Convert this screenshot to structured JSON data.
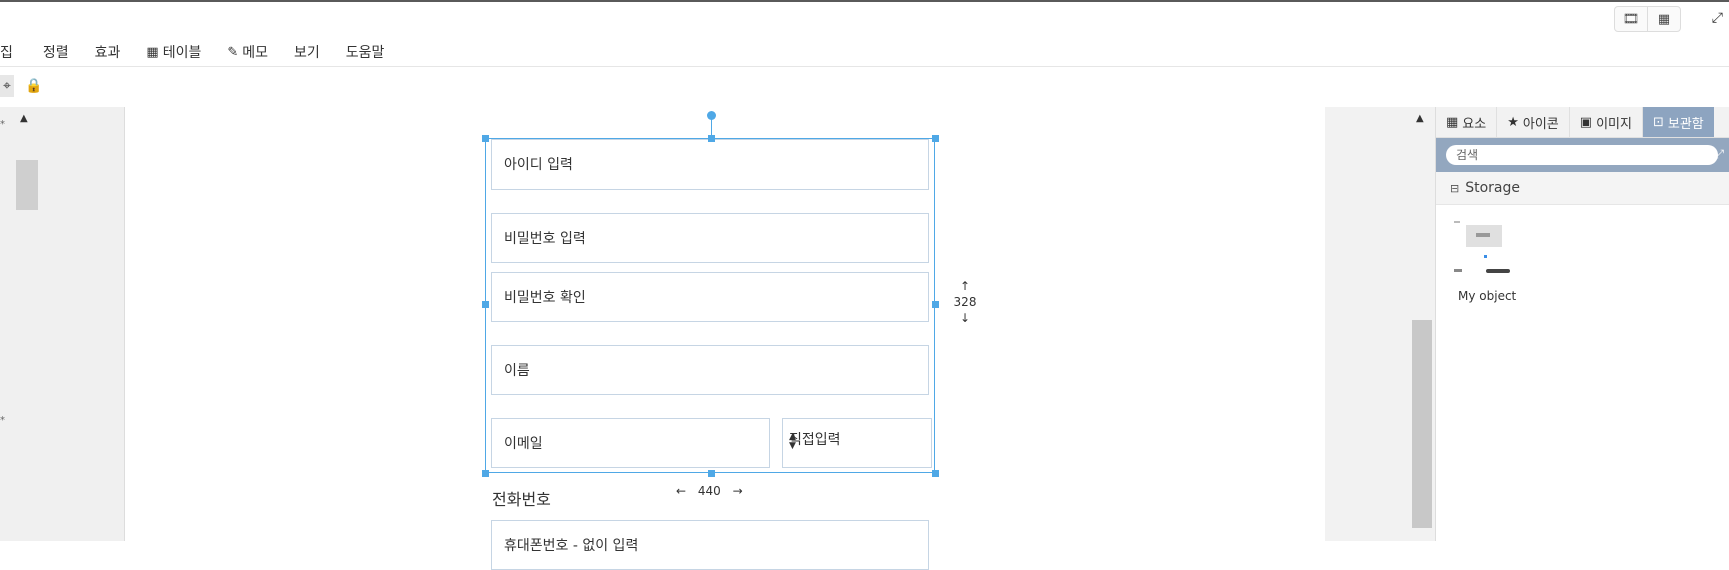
{
  "window": {
    "view_buttons": [
      "film-icon",
      "grid-icon"
    ],
    "expand_icon": "expand-icon"
  },
  "menu": {
    "items": [
      {
        "label": "집"
      },
      {
        "label": "정렬"
      },
      {
        "label": "효과"
      },
      {
        "label": "테이블",
        "icon": "table-icon"
      },
      {
        "label": "메모",
        "icon": "memo-icon"
      },
      {
        "label": "보기"
      },
      {
        "label": "도움말"
      }
    ]
  },
  "panel": {
    "tabs": [
      {
        "label": "요소",
        "icon": "elements-icon"
      },
      {
        "label": "아이콘",
        "icon": "star-icon"
      },
      {
        "label": "이미지",
        "icon": "image-icon"
      },
      {
        "label": "보관함",
        "icon": "storage-icon",
        "active": true
      }
    ],
    "search_placeholder": "검색",
    "storage_title": "Storage",
    "object_name": "My object"
  },
  "canvas": {
    "fields": {
      "id": "아이디 입력",
      "password": "비밀번호 입력",
      "password_confirm": "비밀번호 확인",
      "name": "이름",
      "email": "이메일",
      "email_domain": "직접입력"
    },
    "phone_label": "전화번호",
    "phone_placeholder": "휴대폰번호 - 없이 입력",
    "selection_height": "328",
    "selection_width": "440"
  },
  "colors": {
    "selection": "#4fa8e6",
    "panel_accent": "#93a7bf",
    "active_tab": "#8da4c0"
  }
}
